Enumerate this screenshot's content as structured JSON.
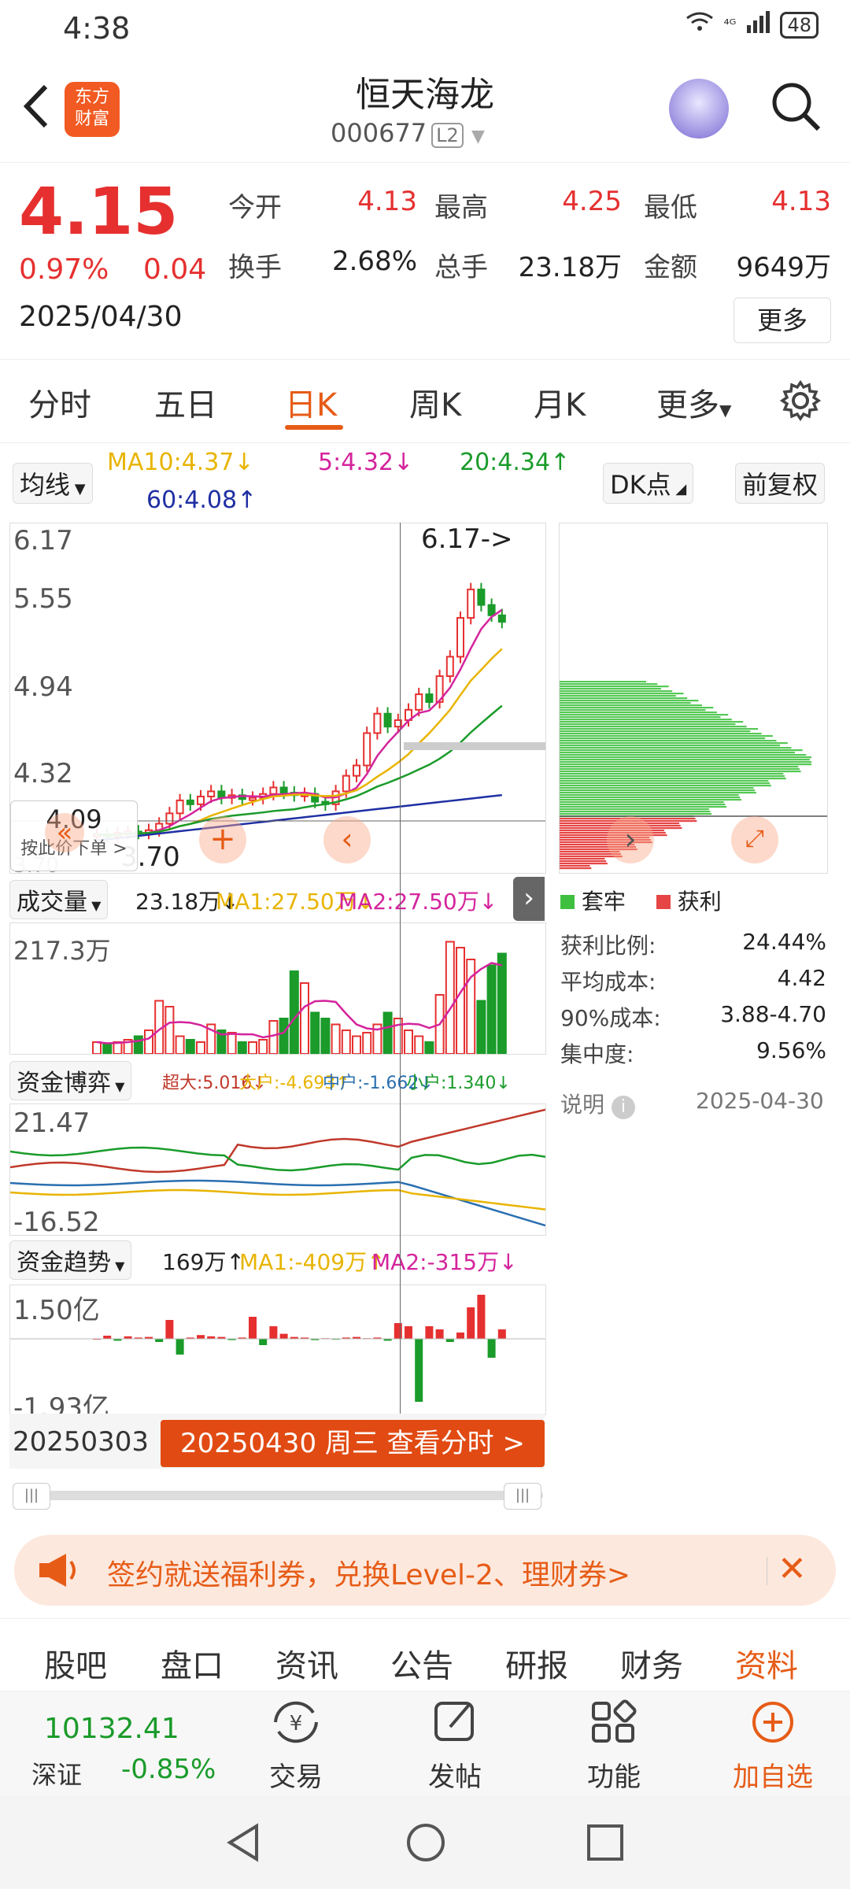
{
  "status": {
    "time": "4:38",
    "net": "⁴ᴳ",
    "battery": "48"
  },
  "header": {
    "logo_line1": "东方",
    "logo_line2": "财富",
    "name": "恒天海龙",
    "code": "000677",
    "level": "L2"
  },
  "quote": {
    "price": "4.15",
    "pct": "0.97%",
    "change": "0.04",
    "date": "2025/04/30",
    "fields": [
      {
        "label": "今开",
        "value": "4.13",
        "color": "red"
      },
      {
        "label": "最高",
        "value": "4.25",
        "color": "red"
      },
      {
        "label": "最低",
        "value": "4.13",
        "color": "red"
      },
      {
        "label": "换手",
        "value": "2.68%",
        "color": "black"
      },
      {
        "label": "总手",
        "value": "23.18万",
        "color": "black"
      },
      {
        "label": "金额",
        "value": "9649万",
        "color": "black"
      }
    ],
    "more": "更多"
  },
  "tabs": [
    "分时",
    "五日",
    "日K",
    "周K",
    "月K",
    "更多"
  ],
  "active_tab": "日K",
  "ma_row": {
    "selector": "均线",
    "ma10": "MA10:4.37↓",
    "ma5": "5:4.32↓",
    "ma20": "20:4.34↑",
    "ma60": "60:4.08↑",
    "dk": "DK点",
    "fq": "前复权"
  },
  "kchart": {
    "y_labels": [
      "6.17",
      "5.55",
      "4.94",
      "4.32"
    ],
    "high_marker": "6.17->",
    "low_label": "3.70",
    "low_partial": "3.70",
    "crosshair_price": "4.09",
    "order_hint": "按此价下单 >"
  },
  "volume": {
    "selector": "成交量",
    "value": "23.18万↓",
    "ma1": "MA1:27.50万↓",
    "ma2": "MA2:27.50万↓",
    "y_top": "217.3万"
  },
  "capital_game": {
    "selector": "资金博弈",
    "super": "超大:5.016↓",
    "large": "大户:-4.693↑",
    "mid": "中户:-1.662↓",
    "small": "小户:1.340↓",
    "y_top": "21.47",
    "y_bottom": "-16.52"
  },
  "capital_trend": {
    "selector": "资金趋势",
    "value": "169万↑",
    "ma1": "MA1:-409万↑",
    "ma2": "MA2:-315万↓",
    "y_top": "1.50亿",
    "y_bottom": "-1.93亿"
  },
  "timeline": {
    "start": "20250303",
    "current": "20250430 周三 查看分时 >"
  },
  "chip_panel": {
    "legend_locked": "套牢",
    "legend_profit": "获利",
    "rows": [
      {
        "label": "获利比例:",
        "value": "24.44%"
      },
      {
        "label": "平均成本:",
        "value": "4.42"
      },
      {
        "label": "90%成本:",
        "value": "3.88-4.70"
      },
      {
        "label": "集中度:",
        "value": "9.56%"
      }
    ],
    "note": "说明",
    "date": "2025-04-30"
  },
  "banner": {
    "text": "签约就送福利券，兑换Level-2、理财券>"
  },
  "bottom_tabs": [
    "股吧",
    "盘口",
    "资讯",
    "公告",
    "研报",
    "财务",
    "资料"
  ],
  "active_bottom_tab": "资料",
  "index": {
    "value": "10132.41",
    "name": "深证",
    "pct": "-0.85%"
  },
  "bottom_bar": [
    "交易",
    "发帖",
    "功能",
    "加自选"
  ],
  "colors": {
    "up": "#e63030",
    "down": "#1a9b2a",
    "accent": "#e65c17",
    "ma5": "#d4249c",
    "ma10": "#e8b400",
    "ma20": "#1a9b2a",
    "ma60": "#1f2fa3"
  }
}
